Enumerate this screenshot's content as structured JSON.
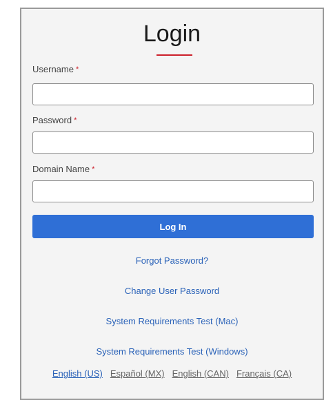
{
  "login": {
    "title": "Login",
    "accent_color": "#cc1f2a",
    "primary_color": "#2f6fd6",
    "link_color": "#2a62b8",
    "required_marker": "*",
    "fields": [
      {
        "label": "Username",
        "value": "",
        "placeholder": ""
      },
      {
        "label": "Password",
        "value": "",
        "placeholder": ""
      },
      {
        "label": "Domain Name",
        "value": "",
        "placeholder": ""
      }
    ],
    "submit_label": "Log In",
    "links": {
      "forgot_password": "Forgot Password?",
      "change_password": "Change User Password",
      "sysreq_mac": "System Requirements Test (Mac)",
      "sysreq_windows": "System Requirements Test (Windows)"
    },
    "languages": [
      {
        "label": "English (US)",
        "selected": true
      },
      {
        "label": "Español (MX)",
        "selected": false
      },
      {
        "label": "English (CAN)",
        "selected": false
      },
      {
        "label": "Français (CA)",
        "selected": false
      }
    ]
  }
}
